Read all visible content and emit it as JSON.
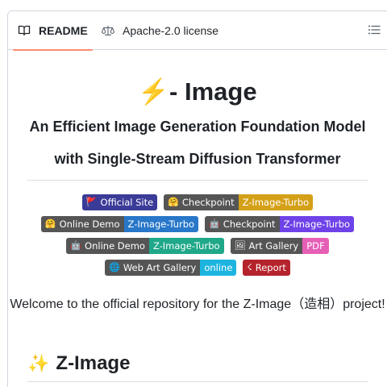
{
  "tabs": {
    "readme_label": "README",
    "license_label": "Apache-2.0 license"
  },
  "header": {
    "title_emoji": "⚡️",
    "title_text": "- Image",
    "subtitle_line1": "An Efficient Image Generation Foundation Model",
    "subtitle_line2": "with Single-Stream Diffusion Transformer"
  },
  "badges": [
    [
      {
        "left": "Official Site",
        "emoji": "🚩",
        "left_color": "#3b3b98",
        "right": "",
        "right_color": ""
      },
      {
        "left": "Checkpoint",
        "emoji": "🤗",
        "left_color": "#555555",
        "right": "Z-Image-Turbo",
        "right_color": "#d4a017"
      }
    ],
    [
      {
        "left": "Online Demo",
        "emoji": "🤗",
        "left_color": "#555555",
        "right": "Z-Image-Turbo",
        "right_color": "#2877c9"
      },
      {
        "left": "Checkpoint",
        "emoji": "🤖",
        "left_color": "#555555",
        "right": "Z-Image-Turbo",
        "right_color": "#6f42e8"
      }
    ],
    [
      {
        "left": "Online Demo",
        "emoji": "🤖",
        "left_color": "#555555",
        "right": "Z-Image-Turbo",
        "right_color": "#1fa889"
      },
      {
        "left": "Art Gallery",
        "emoji": "🖼",
        "left_color": "#555555",
        "right": "PDF",
        "right_color": "#e65fb6"
      }
    ],
    [
      {
        "left": "Web Art Gallery",
        "emoji": "🌐",
        "left_color": "#555555",
        "right": "online",
        "right_color": "#1db5e0"
      },
      {
        "left": "Report",
        "emoji": "☇",
        "left_color": "#b5232c",
        "right": "",
        "right_color": ""
      }
    ]
  ],
  "welcome_text": "Welcome to the official repository for the Z-Image（造相）project!",
  "section_heading": {
    "emoji": "✨",
    "text": "Z-Image"
  }
}
